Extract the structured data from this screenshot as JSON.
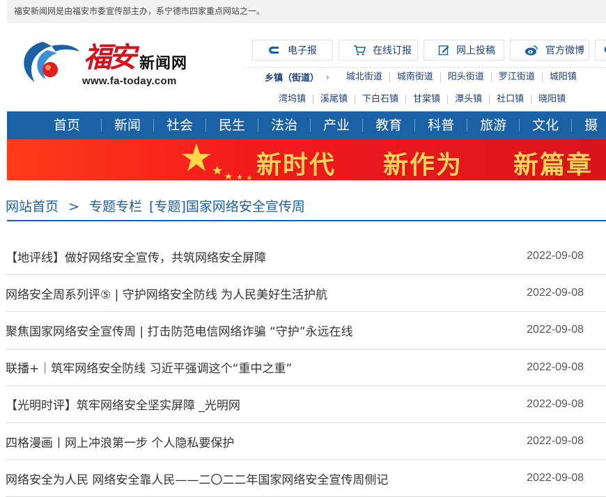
{
  "topbar": {
    "text": "福安新闻网是由福安市委宣传部主办，系宁德市四家重点网站之一。"
  },
  "logo": {
    "brush": "福安",
    "name": "新闻网",
    "url": "www.fa-today.com"
  },
  "quick_links": [
    {
      "label": "电子报",
      "icon": "newspaper-icon"
    },
    {
      "label": "在线订报",
      "icon": "cart-icon"
    },
    {
      "label": "网上投稿",
      "icon": "edit-icon"
    },
    {
      "label": "官方微博",
      "icon": "weibo-icon"
    },
    {
      "label": "",
      "icon": "wechat-icon"
    }
  ],
  "towns": {
    "label": "乡镇（街道）",
    "arrow": "›",
    "row1": [
      "城北街道",
      "城南街道",
      "阳头街道",
      "罗江街道",
      "城阳镇"
    ],
    "row2": [
      "湾坞镇",
      "溪尾镇",
      "下白石镇",
      "甘棠镇",
      "潭头镇",
      "社口镇",
      "晓阳镇"
    ]
  },
  "nav": [
    "首页",
    "新闻",
    "社会",
    "民生",
    "法治",
    "产业",
    "教育",
    "科普",
    "旅游",
    "文化",
    "摄"
  ],
  "banner": {
    "phrases": [
      "新时代",
      "新作为",
      "新篇章"
    ],
    "accent": "#f21b1b",
    "text_color": "#ffd65a"
  },
  "breadcrumb": {
    "home": "网站首页",
    "sep": ">",
    "section": "专题专栏",
    "current": "[专题]国家网络安全宣传周"
  },
  "articles": [
    {
      "title": "【地评线】做好网络安全宣传，共筑网络安全屏障",
      "date": "2022-09-08"
    },
    {
      "title": "网络安全周系列评⑤ | 守护网络安全防线 为人民美好生活护航",
      "date": "2022-09-08"
    },
    {
      "title": "聚焦国家网络安全宣传周 | 打击防范电信网络诈骗 “守护”永远在线",
      "date": "2022-09-08"
    },
    {
      "title": "联播+｜筑牢网络安全防线 习近平强调这个“重中之重”",
      "date": "2022-09-08"
    },
    {
      "title": "【光明时评】筑牢网络安全坚实屏障 _光明网",
      "date": "2022-09-08"
    },
    {
      "title": "四格漫画丨网上冲浪第一步 个人隐私要保护",
      "date": "2022-09-08"
    },
    {
      "title": "网络安全为人民 网络安全靠人民——二〇二二年国家网络安全宣传周侧记",
      "date": "2022-09-08"
    }
  ],
  "colors": {
    "nav": "#1b61a6",
    "link": "#1b5fa6",
    "brand_red": "#d4121b"
  }
}
